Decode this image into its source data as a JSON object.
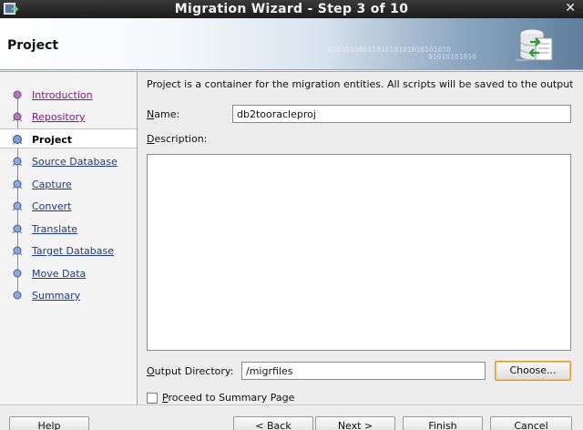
{
  "window": {
    "title": "Migration Wizard - Step 3 of 10",
    "close_glyph": "✕"
  },
  "header": {
    "page_title": "Project",
    "binary_text_1": "0101010001101010101010101010",
    "binary_text_2": "01010101010"
  },
  "nav": {
    "items": [
      {
        "label": "Introduction",
        "state": "visited"
      },
      {
        "label": "Repository",
        "state": "visited"
      },
      {
        "label": "Project",
        "state": "active"
      },
      {
        "label": "Source Database",
        "state": "todo"
      },
      {
        "label": "Capture ",
        "state": "todo"
      },
      {
        "label": "Convert",
        "state": "todo"
      },
      {
        "label": "Translate",
        "state": "todo"
      },
      {
        "label": "Target Database",
        "state": "todo"
      },
      {
        "label": "Move Data",
        "state": "todo"
      },
      {
        "label": "Summary",
        "state": "todo"
      }
    ]
  },
  "main": {
    "description": "Project is a container for the migration entities.  All scripts will be saved to the output ...",
    "name_label_mnemonic": "N",
    "name_label_rest": "ame:",
    "name_value": "db2tooracleproj",
    "description_label_mnemonic": "D",
    "description_label_rest": "escription:",
    "description_value": "",
    "output_label_mnemonic": "O",
    "output_label_rest": "utput Directory:",
    "output_value": "/migrfiles",
    "choose_label": "Choose...",
    "proceed_mnemonic": "P",
    "proceed_label_rest": "roceed to Summary Page",
    "proceed_checked": false
  },
  "buttons": {
    "help": "Help",
    "back": "< Back",
    "next": "Next >",
    "finish": "Finish",
    "cancel": "Cancel"
  },
  "colors": {
    "visited_link": "#7c1a80",
    "todo_link": "#1f3b7a",
    "focus_border": "#d59a2a",
    "title_bar": "#1c1c1c"
  }
}
